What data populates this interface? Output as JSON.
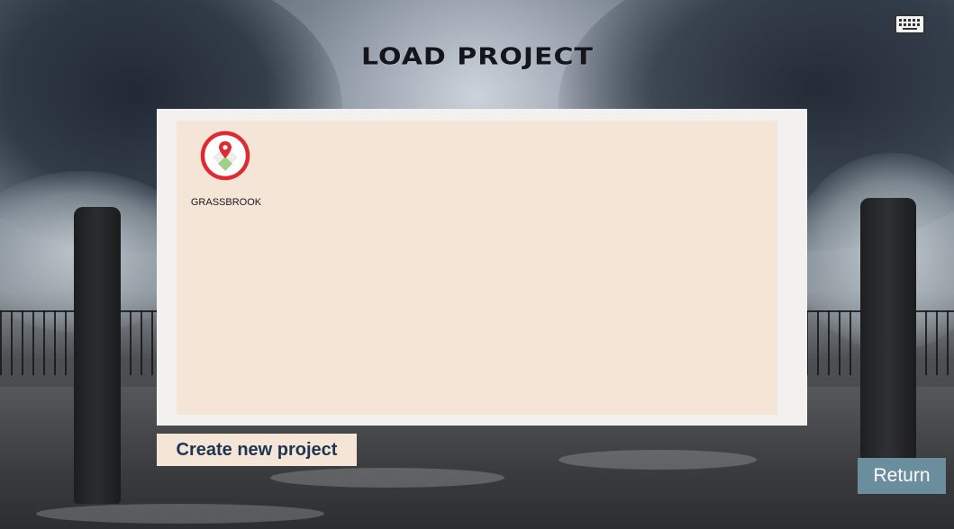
{
  "screen": {
    "title": "LOAD PROJECT"
  },
  "toolbar": {
    "keyboard_icon": "keyboard-icon"
  },
  "projects": [
    {
      "name": "GRASSBROOK",
      "icon": "map-pin-icon"
    }
  ],
  "actions": {
    "create_label": "Create new project",
    "return_label": "Return"
  },
  "colors": {
    "panel_frame": "#f2f1ef",
    "panel_fill": "#f5e5d6",
    "create_button_bg": "#f5e5d6",
    "create_button_text": "#1d3552",
    "return_button_bg": "#6b8e9e",
    "return_button_text": "#ffffff",
    "pin_ring": "#e02a33",
    "pin_green": "#9fd08a"
  }
}
